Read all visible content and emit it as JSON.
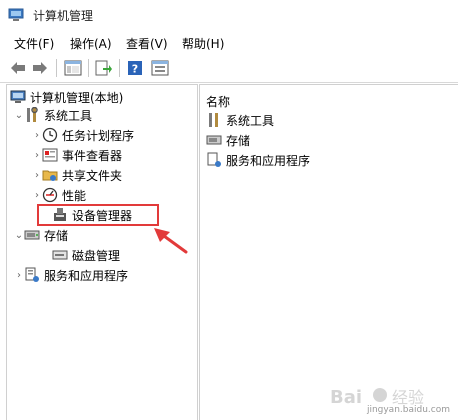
{
  "window": {
    "title": "计算机管理"
  },
  "menu": [
    "文件(F)",
    "操作(A)",
    "查看(V)",
    "帮助(H)"
  ],
  "tree": {
    "root": "计算机管理(本地)",
    "system_tools": "系统工具",
    "task_scheduler": "任务计划程序",
    "event_viewer": "事件查看器",
    "shared_folders": "共享文件夹",
    "performance": "性能",
    "device_manager": "设备管理器",
    "storage": "存储",
    "disk_management": "磁盘管理",
    "services_apps": "服务和应用程序"
  },
  "right": {
    "header": "名称",
    "items": [
      "系统工具",
      "存储",
      "服务和应用程序"
    ]
  },
  "watermark": {
    "text": "jingyan.baidu.com"
  },
  "colors": {
    "highlight": "#e23a3a",
    "accent": "#1e6fc2"
  }
}
